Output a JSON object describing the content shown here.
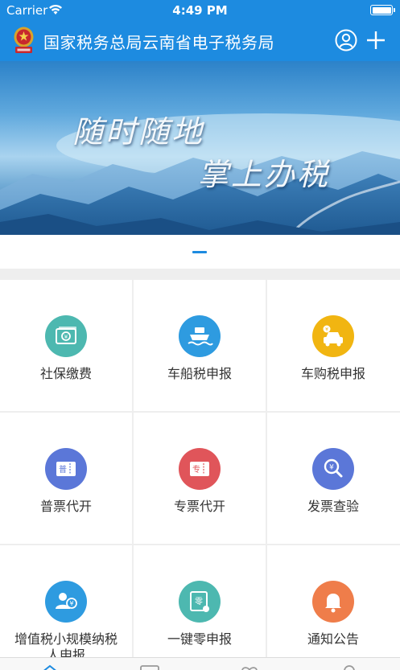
{
  "status_bar": {
    "carrier": "Carrier",
    "time": "4:49 PM"
  },
  "nav": {
    "title": "国家税务总局云南省电子税务局",
    "background": "#1d8be0"
  },
  "banner": {
    "slogan_line1": "随时随地",
    "slogan_line2": "掌上办税",
    "page_count": 1,
    "current_page": 1
  },
  "services": [
    {
      "label": "社保缴费",
      "icon": "banknote-icon",
      "color": "#4db8b0"
    },
    {
      "label": "车船税申报",
      "icon": "ship-icon",
      "color": "#2e9be0"
    },
    {
      "label": "车购税申报",
      "icon": "car-icon",
      "color": "#f1b511"
    },
    {
      "label": "普票代开",
      "icon": "general-invoice-icon",
      "color": "#5b77d8"
    },
    {
      "label": "专票代开",
      "icon": "special-invoice-icon",
      "color": "#e0555a"
    },
    {
      "label": "发票查验",
      "icon": "magnify-invoice-icon",
      "color": "#5b77d8"
    },
    {
      "label": "增值税小规模纳税人申报",
      "icon": "user-currency-icon",
      "color": "#2e9be0"
    },
    {
      "label": "一键零申报",
      "icon": "zero-declare-icon",
      "color": "#4db8b0"
    },
    {
      "label": "通知公告",
      "icon": "bell-icon",
      "color": "#ef7d4a"
    }
  ],
  "tab_bar": {
    "tabs": [
      "home-tab-icon",
      "message-tab-icon",
      "service-tab-icon",
      "profile-tab-icon"
    ]
  }
}
